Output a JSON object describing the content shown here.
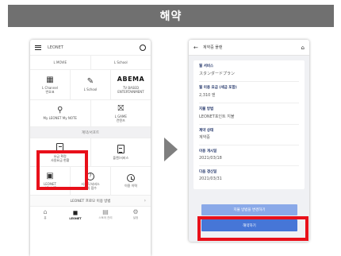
{
  "banner": {
    "title": "해약"
  },
  "left_phone": {
    "header": {
      "logo": "LEONET"
    },
    "row1": [
      "L MOVIE",
      "L School"
    ],
    "row2": [
      {
        "icon": "calendar-icon",
        "label": "L Channel\n번호표"
      },
      {
        "icon": "pencil-icon",
        "label": "L School"
      },
      {
        "icon": "abema-logo",
        "logo_text": "ABEMA",
        "label": "TV BASED\nENTERTAINMENT"
      }
    ],
    "row3": [
      {
        "icon": "person-icon",
        "label": "My LEONET My NOTE"
      },
      {
        "icon": "gift-icon",
        "label": "L GAME\n컨텐츠"
      }
    ],
    "section_title": "계약/서포트",
    "row4": [
      {
        "icon": "document-icon",
        "label": "요금 확정\n사용요금 현황"
      },
      {
        "icon": "document-icon",
        "label": "플랜/서비스"
      }
    ],
    "row5": [
      {
        "icon": "id-card-icon",
        "label": "LEONET\n사용자 ID"
      },
      {
        "icon": "question-icon",
        "label": "서포트/서비스\n문의 접수"
      },
      {
        "icon": "clock-icon",
        "label": "이용 이력"
      }
    ],
    "promo": {
      "text": "LEONET 프로모 이용 방법",
      "chevron": "›"
    },
    "bottom_nav": [
      {
        "icon": "home-icon",
        "label": "홈"
      },
      {
        "icon": "leonet-icon",
        "label": "LEONET"
      },
      {
        "icon": "store-icon",
        "label": "스토어 관리"
      },
      {
        "icon": "settings-icon",
        "label": "설정"
      }
    ]
  },
  "right_phone": {
    "header": {
      "back": "←",
      "title": "계약중 플랜",
      "home": "⌂"
    },
    "fields": [
      {
        "label": "월 서비스",
        "value": "スタンダードプラン"
      },
      {
        "label": "월 이용 요금 (세금 포함)",
        "value": "2,310 엔"
      },
      {
        "label": "지불 방법",
        "value": "LEONET포인트 지불"
      },
      {
        "label": "계약 상태",
        "value": "계약중"
      },
      {
        "label": "이용 개시일",
        "value": "2021/03/18"
      },
      {
        "label": "다음 갱신일",
        "value": "2021/03/31"
      }
    ],
    "buttons": {
      "change": "지불 방법을 변경하기",
      "cancel": "해약하기"
    }
  },
  "colors": {
    "banner": "#707070",
    "highlight": "#e8101a",
    "primary_button": "#4676d7",
    "secondary_button": "#8aa9e8",
    "label_blue": "#23366a"
  }
}
